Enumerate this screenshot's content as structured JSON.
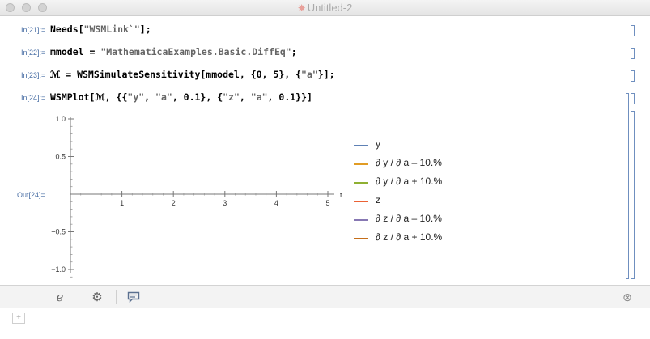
{
  "window": {
    "title": "Untitled-2"
  },
  "cells": [
    {
      "label": "In[21]:=",
      "parts": [
        {
          "t": "Needs[",
          "c": "var"
        },
        {
          "t": "\"WSMLink`\"",
          "c": "str"
        },
        {
          "t": "];",
          "c": "var"
        }
      ]
    },
    {
      "label": "In[22]:=",
      "parts": [
        {
          "t": "mmodel = ",
          "c": "var"
        },
        {
          "t": "\"MathematicaExamples.Basic.DiffEq\"",
          "c": "str"
        },
        {
          "t": ";",
          "c": "var"
        }
      ]
    },
    {
      "label": "In[23]:=",
      "parts": [
        {
          "t": "ℳ = WSMSimulateSensitivity[mmodel, {0, 5}, {",
          "c": "var"
        },
        {
          "t": "\"a\"",
          "c": "str"
        },
        {
          "t": "}];",
          "c": "var"
        }
      ]
    },
    {
      "label": "In[24]:=",
      "parts": [
        {
          "t": "WSMPlot[ℳ, {{",
          "c": "var"
        },
        {
          "t": "\"y\"",
          "c": "str"
        },
        {
          "t": ", ",
          "c": "var"
        },
        {
          "t": "\"a\"",
          "c": "str"
        },
        {
          "t": ", 0.1}, {",
          "c": "var"
        },
        {
          "t": "\"z\"",
          "c": "str"
        },
        {
          "t": ", ",
          "c": "var"
        },
        {
          "t": "\"a\"",
          "c": "str"
        },
        {
          "t": ", 0.1}}]",
          "c": "var"
        }
      ]
    }
  ],
  "output": {
    "label": "Out[24]="
  },
  "chart_data": {
    "type": "line",
    "x_ticks": [
      "1",
      "2",
      "3",
      "4",
      "5"
    ],
    "y_ticks": [
      "1.0",
      "0.5",
      "-0.5",
      "-1.0"
    ],
    "xlabel": "t",
    "xlim": [
      0,
      5.2
    ],
    "ylim": [
      -1.1,
      1.1
    ],
    "series": [
      {
        "name": "y",
        "color": "#5e81b5",
        "values": []
      },
      {
        "name": "∂ y / ∂ a – 10.%",
        "color": "#e19c24",
        "values": []
      },
      {
        "name": "∂ y / ∂ a + 10.%",
        "color": "#8fb032",
        "values": []
      },
      {
        "name": "z",
        "color": "#eb6235",
        "values": []
      },
      {
        "name": "∂ z / ∂ a – 10.%",
        "color": "#8778b3",
        "values": []
      },
      {
        "name": "∂ z / ∂ a + 10.%",
        "color": "#c56e1a",
        "values": []
      }
    ]
  },
  "toolbar": {
    "items": [
      {
        "name": "suggestions-icon",
        "glyph": "ℯ"
      },
      {
        "name": "gear-icon",
        "glyph": "⚙"
      },
      {
        "name": "comment-icon",
        "glyph": "💬"
      }
    ],
    "close_glyph": "⊗"
  },
  "bottom": {
    "plus_glyph": "+"
  }
}
